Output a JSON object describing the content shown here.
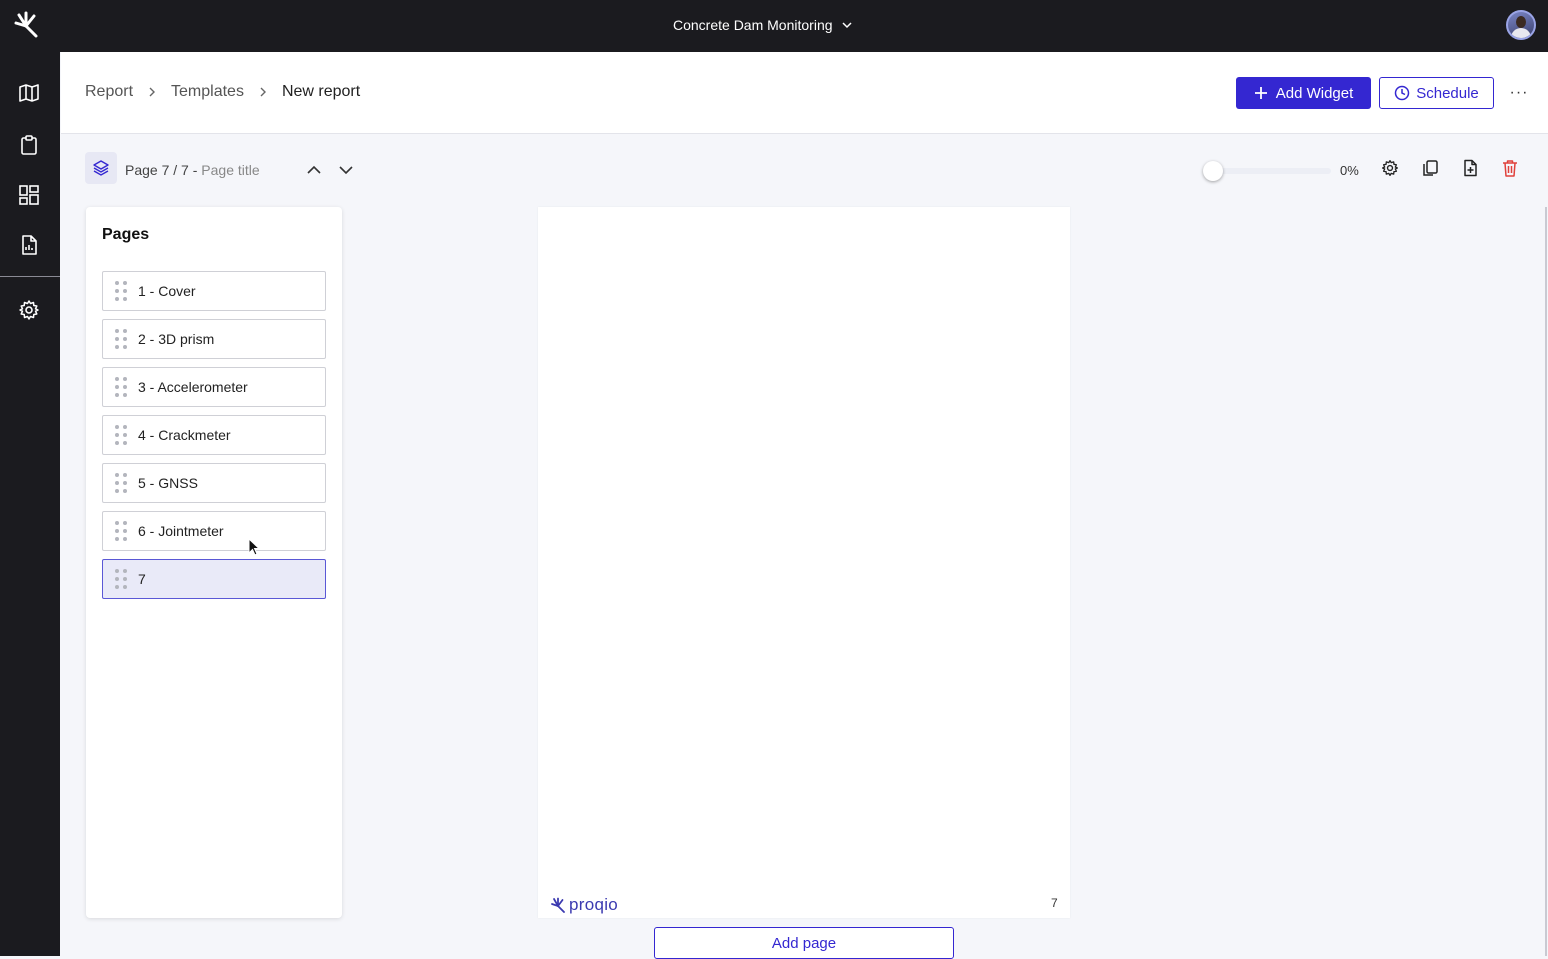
{
  "topbar": {
    "project_name": "Concrete Dam Monitoring",
    "logo_icon": "prism-logo-icon",
    "avatar_icon": "user-avatar"
  },
  "sidebar": {
    "items": [
      {
        "icon": "map-icon"
      },
      {
        "icon": "clipboard-icon"
      },
      {
        "icon": "dashboard-icon"
      },
      {
        "icon": "report-icon"
      },
      {
        "icon": "gear-icon"
      }
    ]
  },
  "breadcrumb": {
    "items": [
      "Report",
      "Templates"
    ],
    "current": "New report"
  },
  "header": {
    "add_widget_label": "Add Widget",
    "schedule_label": "Schedule",
    "more_label": "···"
  },
  "toolbar": {
    "page_indicator": "Page 7 / 7 -",
    "page_title_placeholder": "Page title",
    "zoom": 0,
    "zoom_label": "0%"
  },
  "pages": {
    "title": "Pages",
    "items": [
      {
        "label": "1 - Cover"
      },
      {
        "label": "2 - 3D prism"
      },
      {
        "label": "3 - Accelerometer"
      },
      {
        "label": "4 - Crackmeter"
      },
      {
        "label": "5 - GNSS"
      },
      {
        "label": "6 - Jointmeter"
      },
      {
        "label": "7"
      }
    ],
    "active_index": 6
  },
  "canvas": {
    "logo_text": "proqio",
    "page_number": "7"
  },
  "add_page_label": "Add page",
  "colors": {
    "brand": "#3427d1",
    "topbar": "#1b1b1f",
    "delete": "#e0403a"
  }
}
